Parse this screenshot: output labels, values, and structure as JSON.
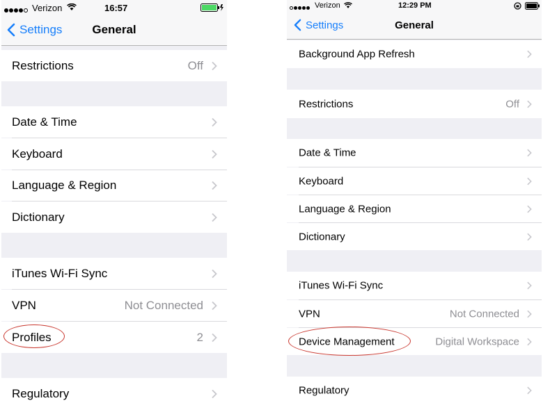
{
  "left": {
    "status": {
      "carrier": "Verizon",
      "time": "16:57"
    },
    "nav": {
      "back_label": "Settings",
      "title": "General"
    },
    "rows": {
      "restrictions": {
        "label": "Restrictions",
        "detail": "Off"
      },
      "date_time": {
        "label": "Date & Time"
      },
      "keyboard": {
        "label": "Keyboard"
      },
      "language_region": {
        "label": "Language & Region"
      },
      "dictionary": {
        "label": "Dictionary"
      },
      "itunes_wifi_sync": {
        "label": "iTunes Wi-Fi Sync"
      },
      "vpn": {
        "label": "VPN",
        "detail": "Not Connected"
      },
      "profiles": {
        "label": "Profiles",
        "detail": "2"
      },
      "regulatory": {
        "label": "Regulatory"
      }
    }
  },
  "right": {
    "status": {
      "carrier": "Verizon",
      "time": "12:29 PM"
    },
    "nav": {
      "back_label": "Settings",
      "title": "General"
    },
    "rows": {
      "background_app_refresh": {
        "label": "Background App Refresh"
      },
      "restrictions": {
        "label": "Restrictions",
        "detail": "Off"
      },
      "date_time": {
        "label": "Date & Time"
      },
      "keyboard": {
        "label": "Keyboard"
      },
      "language_region": {
        "label": "Language & Region"
      },
      "dictionary": {
        "label": "Dictionary"
      },
      "itunes_wifi_sync": {
        "label": "iTunes Wi-Fi Sync"
      },
      "vpn": {
        "label": "VPN",
        "detail": "Not Connected"
      },
      "device_management": {
        "label": "Device Management",
        "detail": "Digital Workspace"
      },
      "regulatory": {
        "label": "Regulatory"
      }
    }
  },
  "colors": {
    "accent": "#157efb",
    "highlight_circle": "#c8332a",
    "battery": "#4cd964",
    "group_bg": "#efeff4"
  }
}
